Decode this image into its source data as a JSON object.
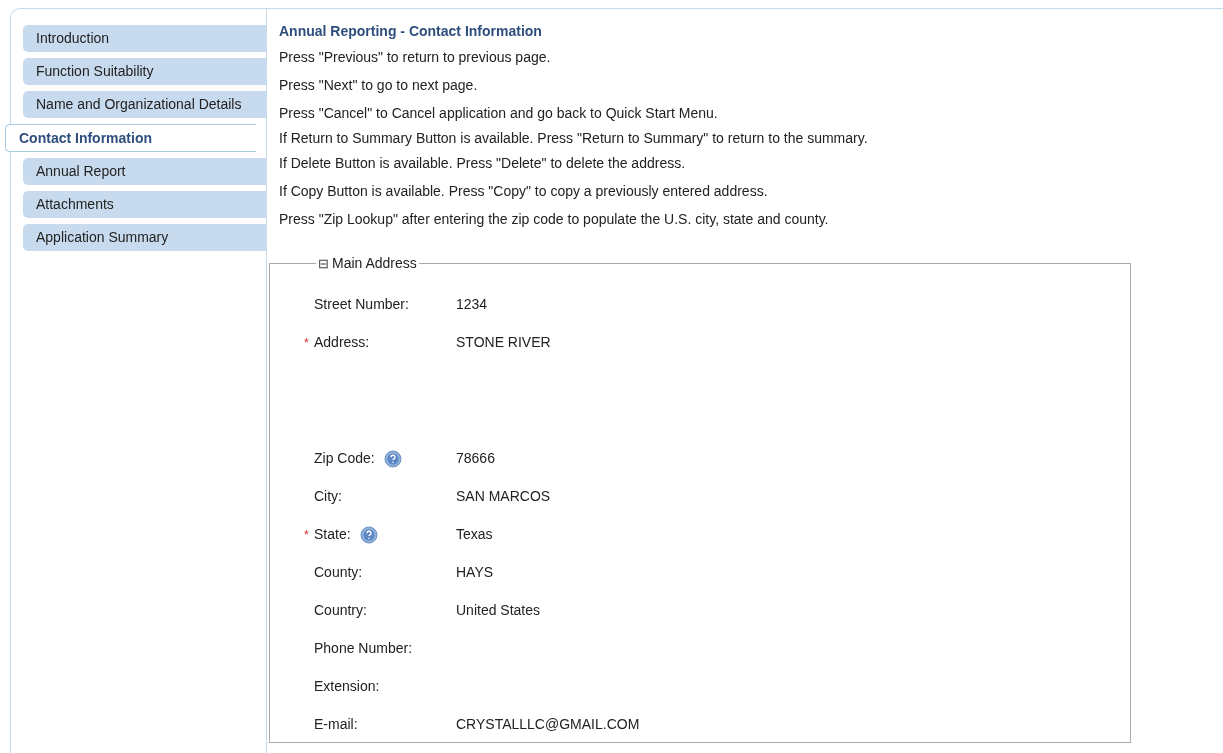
{
  "sidebar": {
    "items": [
      {
        "label": "Introduction",
        "selected": false
      },
      {
        "label": "Function Suitability",
        "selected": false
      },
      {
        "label": "Name and Organizational Details",
        "selected": false
      },
      {
        "label": "Contact Information",
        "selected": true
      },
      {
        "label": "Annual Report",
        "selected": false
      },
      {
        "label": "Attachments",
        "selected": false
      },
      {
        "label": "Application Summary",
        "selected": false
      }
    ]
  },
  "title": "Annual Reporting - Contact Information",
  "instructions": [
    "Press \"Previous\" to return to previous page.",
    "Press \"Next\" to go to next page.",
    "Press \"Cancel\" to Cancel application and go back to Quick Start Menu.",
    "If Return to Summary Button is available. Press \"Return to Summary\" to return to the summary.",
    "If Delete Button is available. Press \"Delete\" to delete the address.",
    "If Copy Button is available. Press \"Copy\" to copy a previously entered address.",
    "Press \"Zip Lookup\" after entering the zip code to populate the U.S. city, state and county."
  ],
  "section": {
    "toggle": "⊟",
    "title": "Main Address",
    "fields": [
      {
        "label": "Street Number:",
        "value": "1234",
        "help": false,
        "kind": "line"
      },
      {
        "marker": "*",
        "label": "Address:",
        "value": "STONE RIVER",
        "help": false,
        "kind": "multiline"
      },
      {
        "label": "Zip Code:",
        "value": "78666",
        "help": true,
        "kind": "line"
      },
      {
        "label": "City:",
        "value": "SAN MARCOS",
        "help": false,
        "kind": "line"
      },
      {
        "marker": "*",
        "label": "State:",
        "value": "Texas",
        "help": true,
        "kind": "line"
      },
      {
        "label": "County:",
        "value": "HAYS",
        "help": false,
        "kind": "line"
      },
      {
        "label": "Country:",
        "value": "United States",
        "help": false,
        "kind": "line"
      },
      {
        "label": "Phone Number:",
        "help": false,
        "kind": "line"
      },
      {
        "label": "Extension:",
        "help": false,
        "kind": "line"
      },
      {
        "label": "E-mail:",
        "value": "CRYSTALLLC@GMAIL.COM",
        "help": false,
        "kind": "line"
      }
    ]
  }
}
